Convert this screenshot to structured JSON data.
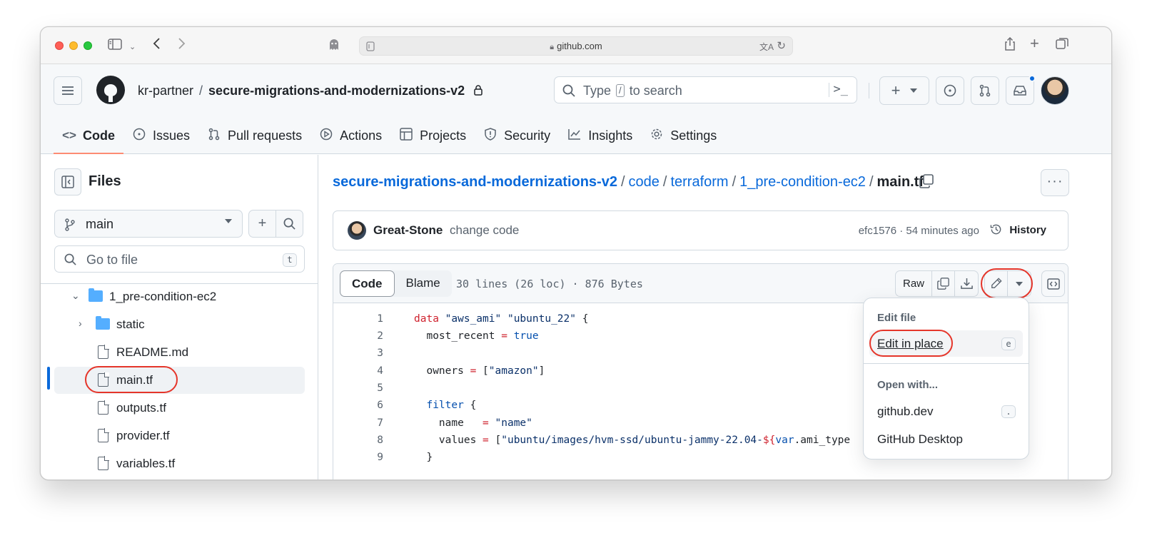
{
  "browser": {
    "url": "github.com",
    "icons": [
      "sidebar-icon",
      "chevron-down-icon",
      "back-icon",
      "forward-icon",
      "privacy-icon",
      "share-icon",
      "new-tab-icon",
      "tabs-icon"
    ]
  },
  "header": {
    "owner": "kr-partner",
    "separator": "/",
    "repo": "secure-migrations-and-modernizations-v2",
    "search_prefix": "Type",
    "search_key": "/",
    "search_suffix": "to search"
  },
  "nav": {
    "items": [
      {
        "label": "Code",
        "icon": "code-icon",
        "active": true
      },
      {
        "label": "Issues",
        "icon": "issue-icon"
      },
      {
        "label": "Pull requests",
        "icon": "pull-request-icon"
      },
      {
        "label": "Actions",
        "icon": "play-icon"
      },
      {
        "label": "Projects",
        "icon": "table-icon"
      },
      {
        "label": "Security",
        "icon": "shield-icon"
      },
      {
        "label": "Insights",
        "icon": "graph-icon"
      },
      {
        "label": "Settings",
        "icon": "gear-icon"
      }
    ]
  },
  "sidebar": {
    "title": "Files",
    "branch": "main",
    "goto_placeholder": "Go to file",
    "goto_key": "t",
    "tree": [
      {
        "label": "1_pre-condition-ec2",
        "type": "folder",
        "expanded": true
      },
      {
        "label": "static",
        "type": "folder",
        "expanded": false
      },
      {
        "label": "README.md",
        "type": "file"
      },
      {
        "label": "main.tf",
        "type": "file",
        "selected": true
      },
      {
        "label": "outputs.tf",
        "type": "file"
      },
      {
        "label": "provider.tf",
        "type": "file"
      },
      {
        "label": "variables.tf",
        "type": "file"
      }
    ]
  },
  "main": {
    "breadcrumb": [
      {
        "label": "secure-migrations-and-modernizations-v2"
      },
      {
        "label": "code"
      },
      {
        "label": "terraform"
      },
      {
        "label": "1_pre-condition-ec2"
      }
    ],
    "breadcrumb_sep": "/",
    "file_name": "main.tf",
    "commit": {
      "author": "Great-Stone",
      "message": "change code",
      "meta": "efc1576 · 54 minutes ago",
      "history_label": "History"
    },
    "code_tabs": {
      "code": "Code",
      "blame": "Blame"
    },
    "stats": "30 lines (26 loc) · 876 Bytes",
    "raw_label": "Raw",
    "lines": [
      {
        "n": "1"
      },
      {
        "n": "2"
      },
      {
        "n": "3"
      },
      {
        "n": "4"
      },
      {
        "n": "5"
      },
      {
        "n": "6"
      },
      {
        "n": "7"
      },
      {
        "n": "8"
      },
      {
        "n": "9"
      }
    ]
  },
  "dropdown": {
    "edit_header": "Edit file",
    "edit_in_place": "Edit in place",
    "edit_key": "e",
    "open_header": "Open with...",
    "github_dev": "github.dev",
    "github_dev_key": ".",
    "github_desktop": "GitHub Desktop"
  },
  "colors": {
    "accent": "#0969da",
    "nav_underline": "#fd8c73",
    "highlight_ring": "#e5352a",
    "keyword": "#cf222e",
    "string": "#0a3069",
    "constant": "#0550ae"
  }
}
